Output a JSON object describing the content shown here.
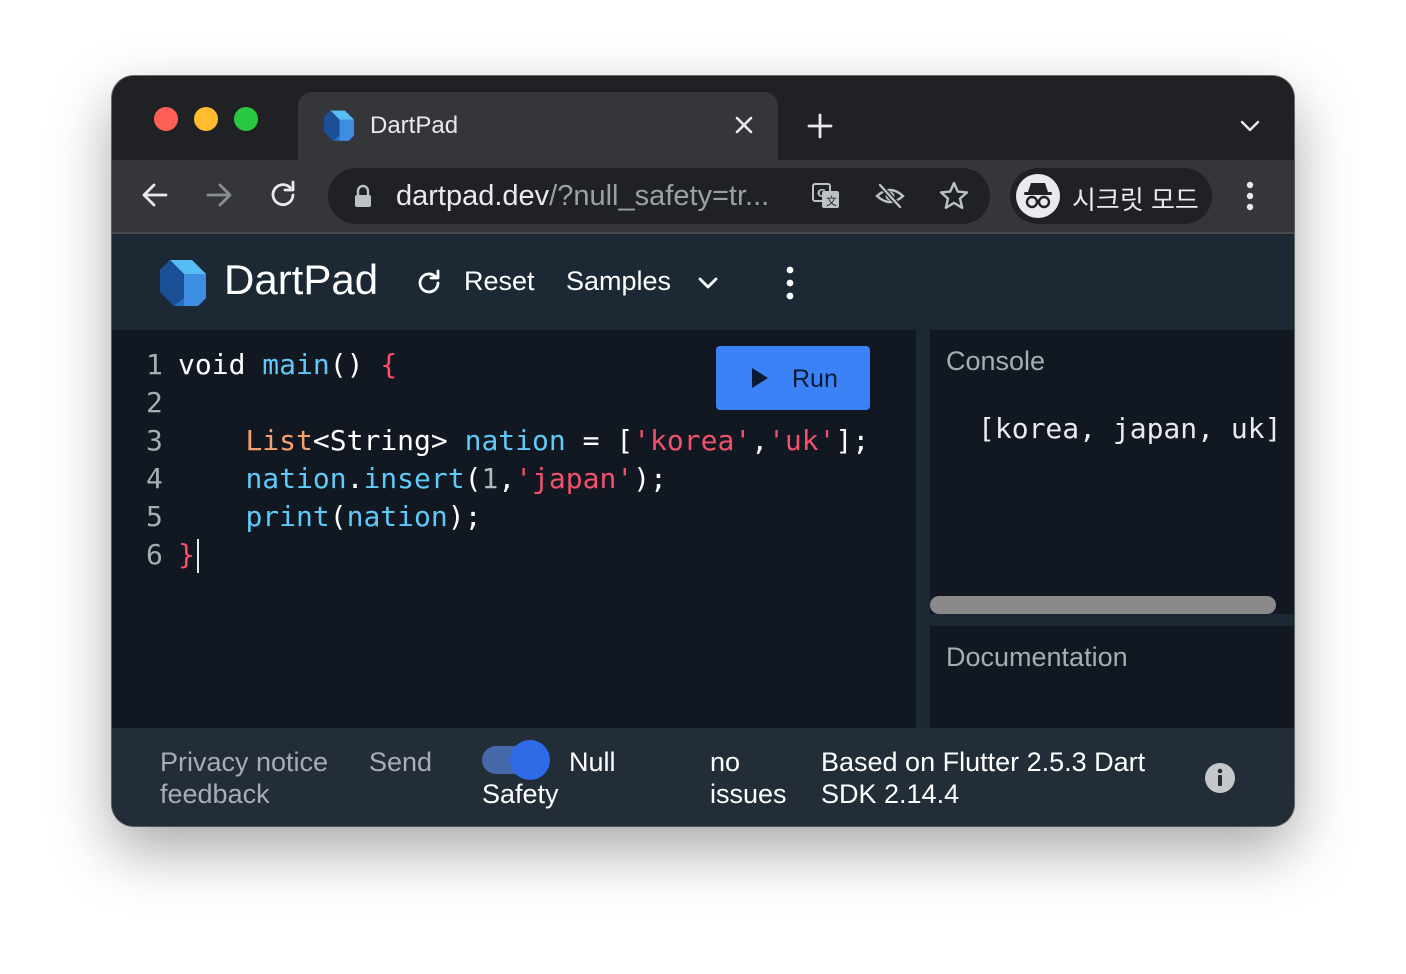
{
  "browser": {
    "tab_title": "DartPad",
    "url_host": "dartpad.dev",
    "url_rest": "/?null_safety=tr...",
    "incognito_label": "시크릿 모드",
    "icons": [
      "back-icon",
      "forward-icon",
      "reload-icon",
      "lock-icon",
      "translate-icon",
      "eye-off-icon",
      "star-icon",
      "incognito-icon",
      "more-vert-icon"
    ]
  },
  "header": {
    "app_title": "DartPad",
    "reset_label": "Reset",
    "samples_label": "Samples"
  },
  "editor": {
    "run_label": "Run",
    "line_numbers": [
      "1",
      "2",
      "3",
      "4",
      "5",
      "6"
    ],
    "lines": [
      [
        {
          "t": "void ",
          "c": "kw"
        },
        {
          "t": "main",
          "c": "fn"
        },
        {
          "t": "() ",
          "c": "kw"
        },
        {
          "t": "{",
          "c": "br"
        }
      ],
      [],
      [
        {
          "t": "    ",
          "c": "kw"
        },
        {
          "t": "List",
          "c": "ty"
        },
        {
          "t": "<String> ",
          "c": "kw"
        },
        {
          "t": "nation",
          "c": "fn"
        },
        {
          "t": " = [",
          "c": "kw"
        },
        {
          "t": "'korea'",
          "c": "st"
        },
        {
          "t": ",",
          "c": "kw"
        },
        {
          "t": "'uk'",
          "c": "st"
        },
        {
          "t": "];",
          "c": "kw"
        }
      ],
      [
        {
          "t": "    ",
          "c": "kw"
        },
        {
          "t": "nation",
          "c": "fn"
        },
        {
          "t": ".",
          "c": "kw"
        },
        {
          "t": "insert",
          "c": "fn"
        },
        {
          "t": "(",
          "c": "kw"
        },
        {
          "t": "1",
          "c": "nm"
        },
        {
          "t": ",",
          "c": "kw"
        },
        {
          "t": "'japan'",
          "c": "st"
        },
        {
          "t": ");",
          "c": "kw"
        }
      ],
      [
        {
          "t": "    ",
          "c": "kw"
        },
        {
          "t": "print",
          "c": "fn"
        },
        {
          "t": "(",
          "c": "kw"
        },
        {
          "t": "nation",
          "c": "fn"
        },
        {
          "t": ");",
          "c": "kw"
        }
      ],
      [
        {
          "t": "}",
          "c": "br"
        }
      ]
    ]
  },
  "console": {
    "title": "Console",
    "output": "[korea, japan, uk]"
  },
  "documentation": {
    "title": "Documentation"
  },
  "statusbar": {
    "privacy_notice": "Privacy notice",
    "send_feedback_1": "Send",
    "send_feedback_2": "feedback",
    "null_safety_1": "Null",
    "null_safety_2": "Safety",
    "null_safety_on": true,
    "issues_1": "no",
    "issues_2": "issues",
    "version_1": "Based on Flutter 2.5.3 Dart",
    "version_2": "SDK 2.14.4"
  },
  "colors": {
    "accent": "#3b82f6",
    "header_bg": "#1c2834",
    "editor_bg": "#121821"
  }
}
